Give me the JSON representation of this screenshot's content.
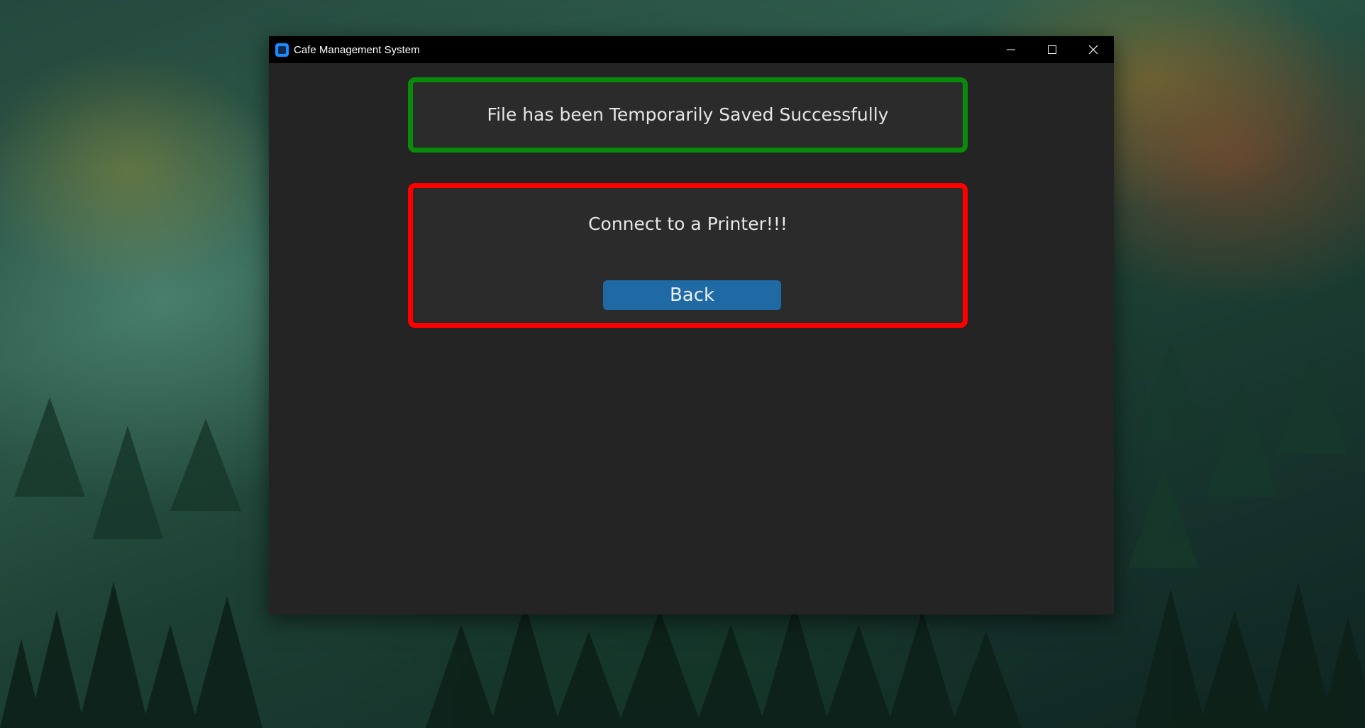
{
  "window": {
    "title": "Cafe Management System",
    "controls": {
      "minimize_icon": "minimize-icon",
      "maximize_icon": "maximize-icon",
      "close_icon": "close-icon"
    }
  },
  "success_panel": {
    "message": "File has been Temporarily Saved Successfully",
    "border_color": "#0a8a0a"
  },
  "printer_panel": {
    "message": "Connect to a Printer!!!",
    "border_color": "#ff0000",
    "back_button_label": "Back",
    "button_color": "#1f6aa5"
  }
}
